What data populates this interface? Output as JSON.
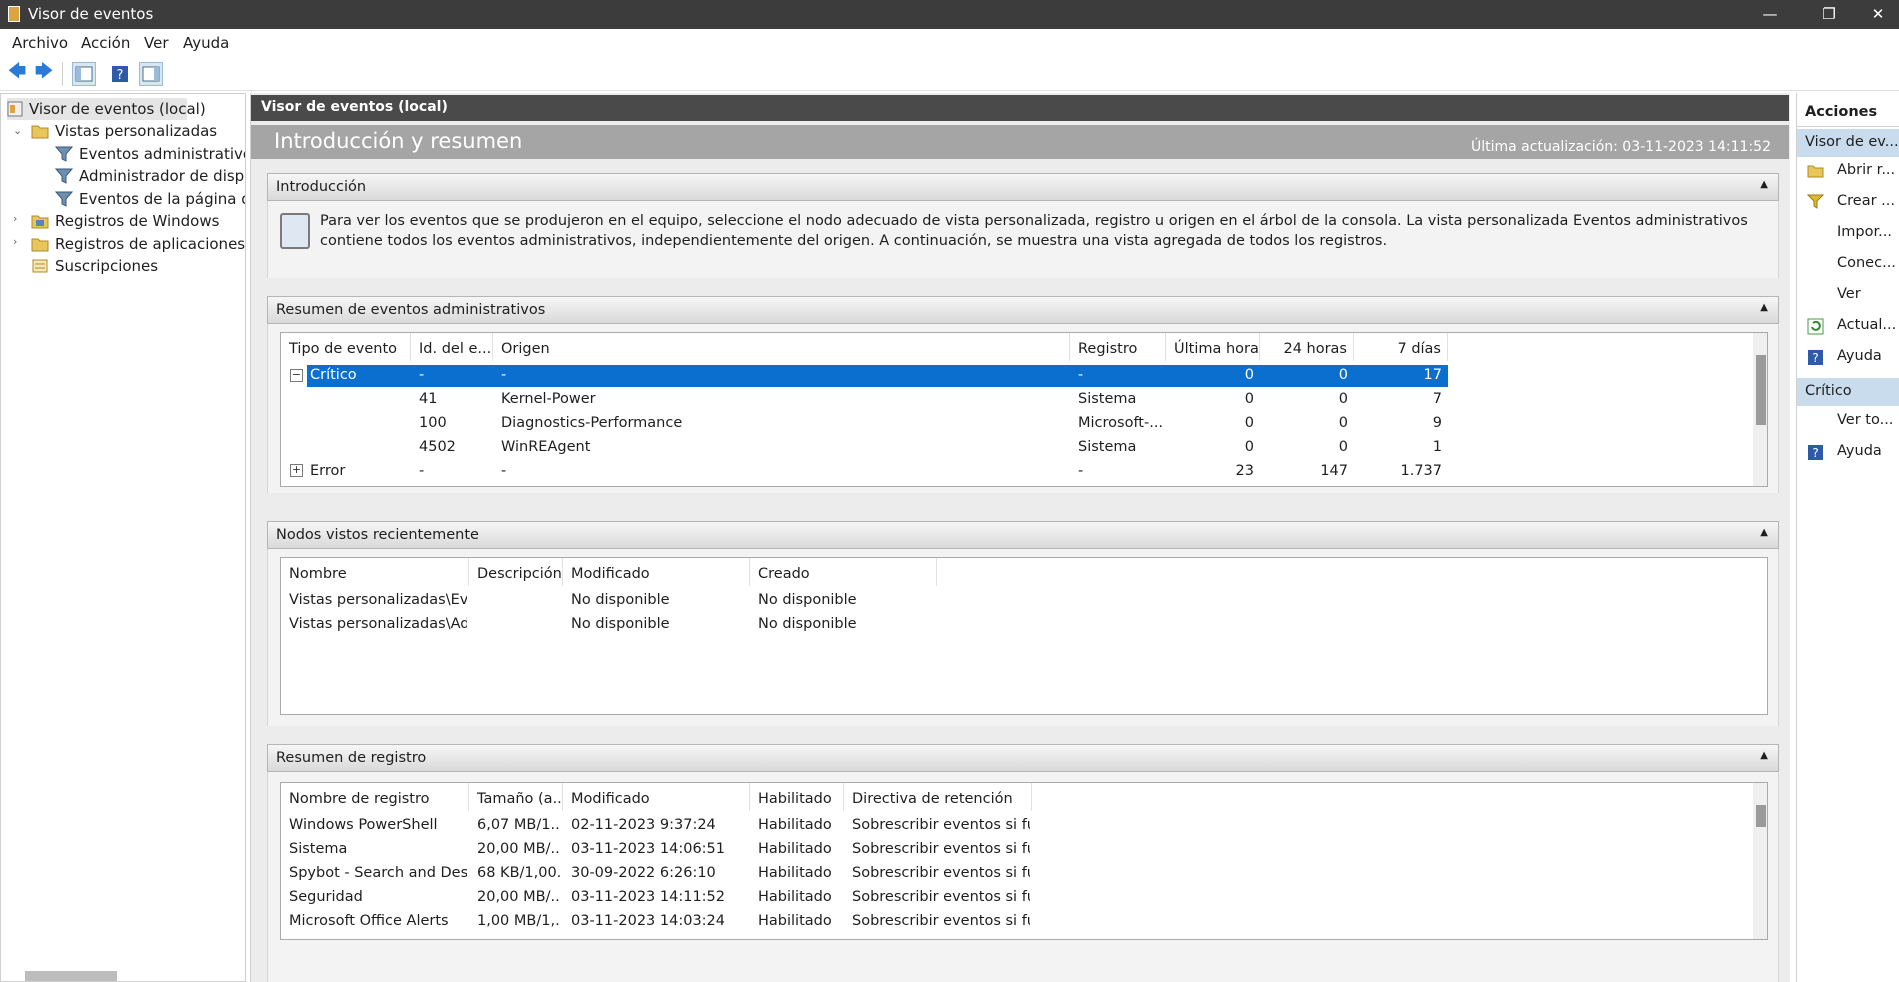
{
  "window": {
    "title": "Visor de eventos"
  },
  "menu": [
    "Archivo",
    "Acción",
    "Ver",
    "Ayuda"
  ],
  "tree": {
    "items": [
      {
        "label": "Visor de eventos (local)"
      },
      {
        "label": "Vistas personalizadas"
      },
      {
        "label": "Eventos administrativos"
      },
      {
        "label": "Administrador de disposi"
      },
      {
        "label": "Eventos de la página de r"
      },
      {
        "label": "Registros de Windows"
      },
      {
        "label": "Registros de aplicaciones y se"
      },
      {
        "label": "Suscripciones"
      }
    ]
  },
  "center": {
    "header": "Visor de eventos (local)",
    "banner_title": "Introducción y resumen",
    "last_update": "Última actualización: 03-11-2023 14:11:52",
    "intro": {
      "title": "Introducción",
      "text": "Para ver los eventos que se produjeron en el equipo, seleccione el nodo adecuado de vista personalizada, registro u origen en el árbol de la consola. La vista personalizada Eventos administrativos contiene todos los eventos administrativos, independientemente del origen. A continuación, se muestra una vista agregada de todos los registros."
    },
    "summary": {
      "title": "Resumen de eventos administrativos",
      "columns": [
        "Tipo de evento",
        "Id. del e...",
        "Origen",
        "Registro",
        "Última hora",
        "24 horas",
        "7 días"
      ],
      "rows": [
        {
          "type": "Crítico",
          "id": "-",
          "source": "-",
          "log": "-",
          "hour": "0",
          "day": "0",
          "week": "17"
        },
        {
          "type": "",
          "id": "41",
          "source": "Kernel-Power",
          "log": "Sistema",
          "hour": "0",
          "day": "0",
          "week": "7"
        },
        {
          "type": "",
          "id": "100",
          "source": "Diagnostics-Performance",
          "log": "Microsoft-...",
          "hour": "0",
          "day": "0",
          "week": "9"
        },
        {
          "type": "",
          "id": "4502",
          "source": "WinREAgent",
          "log": "Sistema",
          "hour": "0",
          "day": "0",
          "week": "1"
        },
        {
          "type": "Error",
          "id": "-",
          "source": "-",
          "log": "-",
          "hour": "23",
          "day": "147",
          "week": "1.737"
        }
      ]
    },
    "recent": {
      "title": "Nodos vistos recientemente",
      "columns": [
        "Nombre",
        "Descripción",
        "Modificado",
        "Creado"
      ],
      "rows": [
        {
          "name": "Vistas personalizadas\\Eve...",
          "desc": "",
          "modified": "No disponible",
          "created": "No disponible"
        },
        {
          "name": "Vistas personalizadas\\Ad...",
          "desc": "",
          "modified": "No disponible",
          "created": "No disponible"
        }
      ]
    },
    "logsummary": {
      "title": "Resumen de registro",
      "columns": [
        "Nombre de registro",
        "Tamaño (a...",
        "Modificado",
        "Habilitado",
        "Directiva de retención"
      ],
      "rows": [
        {
          "name": "Windows PowerShell",
          "size": "6,07 MB/1...",
          "modified": "02-11-2023 9:37:24",
          "enabled": "Habilitado",
          "policy": "Sobrescribir eventos si fu..."
        },
        {
          "name": "Sistema",
          "size": "20,00 MB/...",
          "modified": "03-11-2023 14:06:51",
          "enabled": "Habilitado",
          "policy": "Sobrescribir eventos si fu..."
        },
        {
          "name": "Spybot - Search and Dest...",
          "size": "68 KB/1,00...",
          "modified": "30-09-2022 6:26:10",
          "enabled": "Habilitado",
          "policy": "Sobrescribir eventos si fu..."
        },
        {
          "name": "Seguridad",
          "size": "20,00 MB/...",
          "modified": "03-11-2023 14:11:52",
          "enabled": "Habilitado",
          "policy": "Sobrescribir eventos si fu..."
        },
        {
          "name": "Microsoft Office Alerts",
          "size": "1,00 MB/1,...",
          "modified": "03-11-2023 14:03:24",
          "enabled": "Habilitado",
          "policy": "Sobrescribir eventos si fu..."
        }
      ]
    }
  },
  "actions": {
    "title": "Acciones",
    "group1": "Visor de ev...",
    "items1": [
      {
        "label": "Abrir r...",
        "icon": "open-folder-icon"
      },
      {
        "label": "Crear ...",
        "icon": "filter-icon"
      },
      {
        "label": "Impor...",
        "icon": ""
      },
      {
        "label": "Conec...",
        "icon": ""
      },
      {
        "label": "Ver",
        "icon": ""
      },
      {
        "label": "Actual...",
        "icon": "refresh-icon"
      },
      {
        "label": "Ayuda",
        "icon": "help-icon"
      }
    ],
    "group2": "Crítico",
    "items2": [
      {
        "label": "Ver to...",
        "icon": ""
      },
      {
        "label": "Ayuda",
        "icon": "help-icon"
      }
    ]
  }
}
